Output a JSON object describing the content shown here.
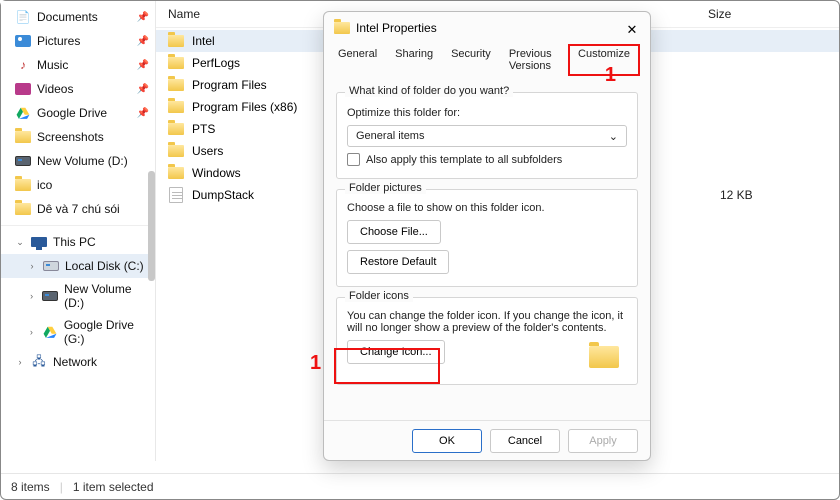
{
  "columns": {
    "name": "Name",
    "size": "Size"
  },
  "sidebar": {
    "items": [
      {
        "label": "Documents",
        "icon": "documents",
        "pinned": true
      },
      {
        "label": "Pictures",
        "icon": "pictures",
        "pinned": true
      },
      {
        "label": "Music",
        "icon": "music",
        "pinned": true
      },
      {
        "label": "Videos",
        "icon": "videos",
        "pinned": true
      },
      {
        "label": "Google Drive",
        "icon": "gdrive",
        "pinned": true
      },
      {
        "label": "Screenshots",
        "icon": "folder"
      },
      {
        "label": "New Volume (D:)",
        "icon": "disk-dark"
      },
      {
        "label": "ico",
        "icon": "folder"
      },
      {
        "label": "Dê và 7 chú sói",
        "icon": "folder"
      }
    ],
    "thispc": {
      "label": "This PC",
      "expanded": true
    },
    "drives": [
      {
        "label": "Local Disk (C:)",
        "icon": "disk",
        "selected": true,
        "chev": "hollow"
      },
      {
        "label": "New Volume (D:)",
        "icon": "disk-dark",
        "chev": "hollow"
      },
      {
        "label": "Google Drive (G:)",
        "icon": "gdrive",
        "chev": "hollow"
      }
    ],
    "network": {
      "label": "Network"
    }
  },
  "files": [
    {
      "name": "Intel",
      "icon": "folder",
      "selected": true
    },
    {
      "name": "PerfLogs",
      "icon": "folder"
    },
    {
      "name": "Program Files",
      "icon": "folder"
    },
    {
      "name": "Program Files (x86)",
      "icon": "folder"
    },
    {
      "name": "PTS",
      "icon": "folder"
    },
    {
      "name": "Users",
      "icon": "folder"
    },
    {
      "name": "Windows",
      "icon": "folder"
    },
    {
      "name": "DumpStack",
      "icon": "file",
      "size": "12 KB"
    }
  ],
  "status": {
    "count": "8 items",
    "selected": "1 item selected"
  },
  "dialog": {
    "title": "Intel Properties",
    "tabs": [
      "General",
      "Sharing",
      "Security",
      "Previous Versions",
      "Customize"
    ],
    "active_tab": 4,
    "kind": {
      "q": "What kind of folder do you want?",
      "optimize": "Optimize this folder for:",
      "combo": "General items",
      "also": "Also apply this template to all subfolders"
    },
    "pictures": {
      "legend": "Folder pictures",
      "hint": "Choose a file to show on this folder icon.",
      "choose": "Choose File...",
      "restore": "Restore Default"
    },
    "icons": {
      "legend": "Folder icons",
      "hint": "You can change the folder icon. If you change the icon, it will no longer show a preview of the folder's contents.",
      "change": "Change Icon..."
    },
    "buttons": {
      "ok": "OK",
      "cancel": "Cancel",
      "apply": "Apply"
    }
  },
  "annotations": {
    "one_a": "1",
    "one_b": "1"
  }
}
